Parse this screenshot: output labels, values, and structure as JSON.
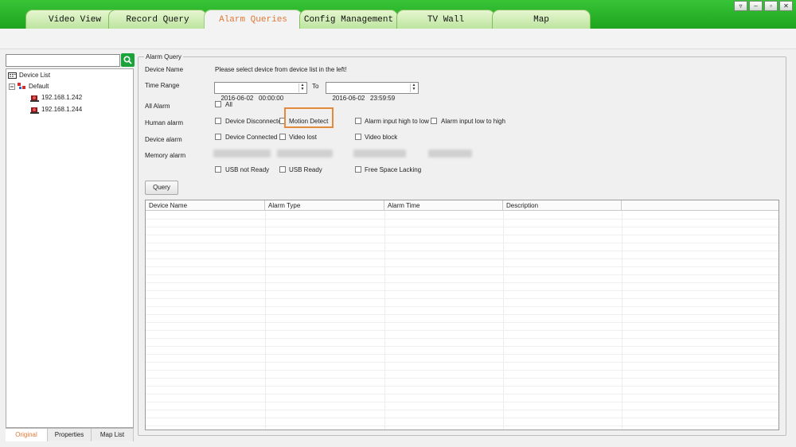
{
  "tabs": [
    {
      "label": "Video View"
    },
    {
      "label": "Record Query"
    },
    {
      "label": "Alarm Queries",
      "active": true
    },
    {
      "label": "Config Management"
    },
    {
      "label": "TV Wall"
    },
    {
      "label": "Map"
    }
  ],
  "window_controls": [
    "▿",
    "‒",
    "▫",
    "✕"
  ],
  "sidebar": {
    "search_value": "",
    "tree": {
      "root": "Device List",
      "group": "Default",
      "devices": [
        "192.168.1.242",
        "192.168.1.244"
      ]
    },
    "tabs": [
      {
        "label": "Original",
        "active": true
      },
      {
        "label": "Properties"
      },
      {
        "label": "Map List"
      }
    ]
  },
  "form": {
    "group_title": "Alarm Query",
    "device_name_label": "Device Name",
    "device_name_hint": "Please select device from device list in the left!",
    "time_range_label": "Time Range",
    "start_time": "2016-06-02   00:00:00",
    "to_label": "To",
    "end_time": "2016-06-02   23:59:59",
    "all_alarm_label": "All Alarm",
    "all_option": "All",
    "human_alarm_label": "Human alarm",
    "device_alarm_label": "Device alarm",
    "memory_alarm_label": "Memory alarm",
    "options": {
      "device_disconnected": "Device Disconnected",
      "motion_detect": "Motion Detect",
      "alarm_high_low": "Alarm input high to low",
      "alarm_low_high": "Alarm input low to high",
      "device_connected": "Device Connected",
      "video_lost": "Video lost",
      "video_block": "Video block",
      "usb_not_ready": "USB not Ready",
      "usb_ready": "USB Ready",
      "free_space_lacking": "Free Space Lacking"
    },
    "query_button": "Query"
  },
  "table": {
    "columns": [
      "Device Name",
      "Alarm Type",
      "Alarm Time",
      "Description"
    ],
    "rows": []
  },
  "colors": {
    "tab_bar": "#22aa22",
    "active_tab_text": "#e0783a",
    "highlight": "#e48a3d"
  }
}
